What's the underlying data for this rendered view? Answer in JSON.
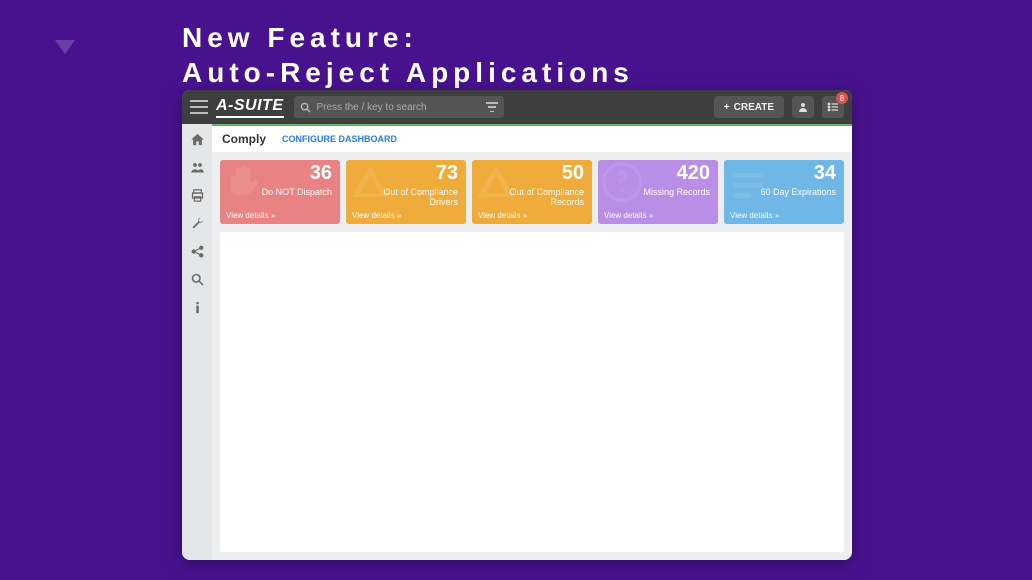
{
  "slide": {
    "title_line1": "New Feature:",
    "title_line2": "Auto-Reject Applications"
  },
  "topbar": {
    "brand": "A-SUITE",
    "search_placeholder": "Press the / key to search",
    "create_label": "CREATE",
    "notification_count": "8"
  },
  "page": {
    "title": "Comply",
    "configure_label": "CONFIGURE DASHBOARD"
  },
  "cards": [
    {
      "value": "36",
      "label": "Do NOT Dispatch",
      "view": "View details »",
      "color": "#e98383",
      "icon": "hand"
    },
    {
      "value": "73",
      "label": "Out of Compliance Drivers",
      "view": "View details »",
      "color": "#efac3a",
      "icon": "warn"
    },
    {
      "value": "50",
      "label": "Out of Compliance Records",
      "view": "View details »",
      "color": "#efac3a",
      "icon": "warn"
    },
    {
      "value": "420",
      "label": "Missing Records",
      "view": "View details »",
      "color": "#b88ee6",
      "icon": "question"
    },
    {
      "value": "34",
      "label": "60 Day Expirations",
      "view": "View details »",
      "color": "#6fb7e6",
      "icon": "lines"
    }
  ]
}
